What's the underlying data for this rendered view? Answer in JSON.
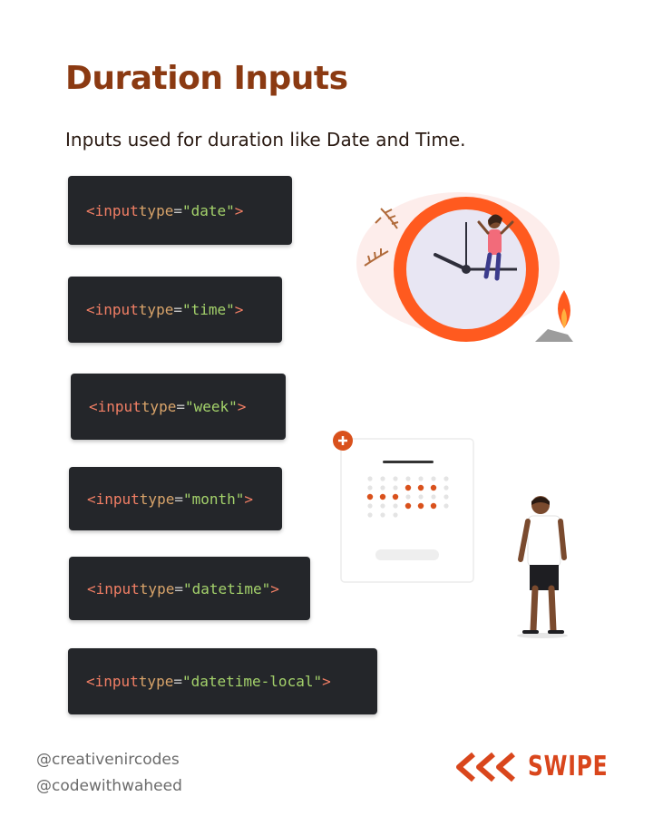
{
  "title": "Duration Inputs",
  "subtitle": "Inputs used for duration like Date and Time.",
  "code_blocks": [
    {
      "tag": "<input",
      "attr": "type",
      "eq": "=",
      "value": "\"date\"",
      "close": ">"
    },
    {
      "tag": "<input",
      "attr": "type",
      "eq": "=",
      "value": "\"time\"",
      "close": ">"
    },
    {
      "tag": "<input",
      "attr": "type",
      "eq": "=",
      "value": "\"week\"",
      "close": ">"
    },
    {
      "tag": "<input",
      "attr": "type",
      "eq": "=",
      "value": "\"month\"",
      "close": ">"
    },
    {
      "tag": "<input",
      "attr": "type",
      "eq": "=",
      "value": "\"datetime\"",
      "close": ">"
    },
    {
      "tag": "<input",
      "attr": "type",
      "eq": "=",
      "value": "\"datetime-local\"",
      "close": ">"
    }
  ],
  "handles": [
    "@creativenircodes",
    "@codewithwaheed"
  ],
  "swipe": {
    "label": "SWIPE",
    "icon": "triple-chevron-left-icon",
    "color": "#d9461c"
  },
  "colors": {
    "title": "#8b3a12",
    "accent": "#ff5a1f",
    "code_bg": "#24262a"
  }
}
